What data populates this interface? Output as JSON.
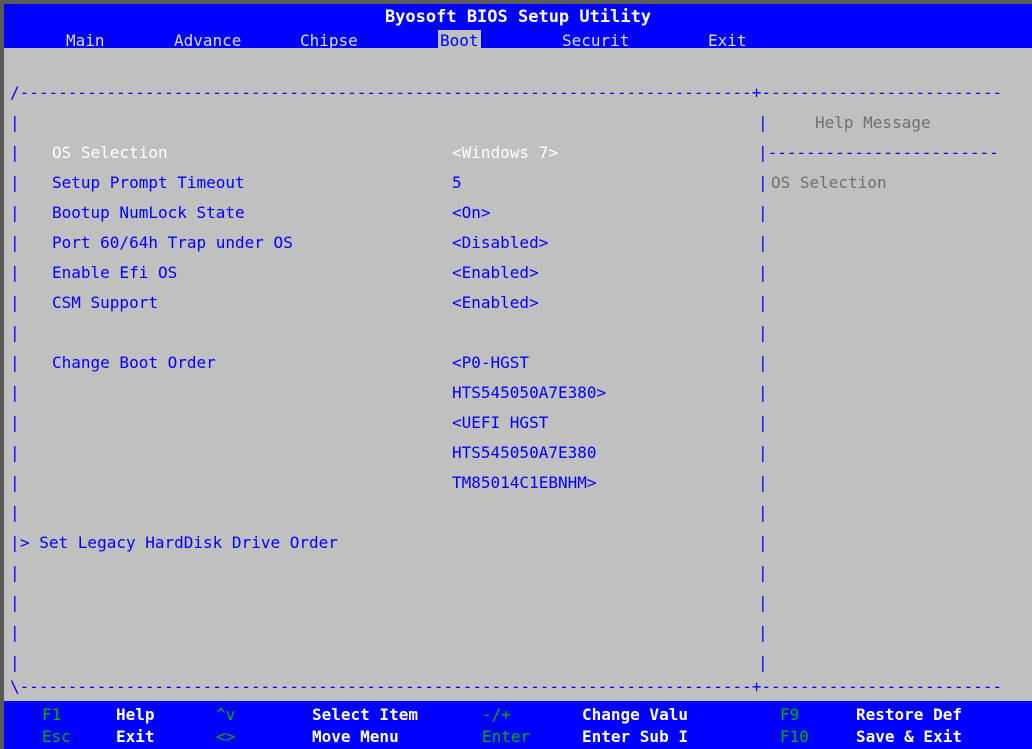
{
  "title": "Byosoft BIOS Setup Utility",
  "tabs": [
    {
      "label": "Main",
      "active": false
    },
    {
      "label": "Advance",
      "active": false
    },
    {
      "label": "Chipse",
      "active": false
    },
    {
      "label": "Boot",
      "active": true
    },
    {
      "label": "Securit",
      "active": false
    },
    {
      "label": "Exit",
      "active": false
    }
  ],
  "frame": {
    "top_border": "/----------------------------------------------------------------------------+-------------------------",
    "bottom_border": "\\----------------------------------------------------------------------------+-------------------------",
    "help_divider": "|------------------------",
    "pipe": "|"
  },
  "settings": [
    {
      "label": "OS Selection",
      "value": "<Windows 7>",
      "highlighted": true
    },
    {
      "label": "Setup Prompt Timeout",
      "value": "5"
    },
    {
      "label": "Bootup NumLock State",
      "value": "<On>"
    },
    {
      "label": "Port 60/64h Trap under OS",
      "value": "<Disabled>"
    },
    {
      "label": "Enable Efi OS",
      "value": "<Enabled>"
    },
    {
      "label": "CSM Support",
      "value": "<Enabled>"
    }
  ],
  "boot_order": {
    "label": "Change Boot Order",
    "values": [
      "<P0-HGST",
      "HTS545050A7E380>",
      "<UEFI HGST",
      "HTS545050A7E380",
      "TM85014C1EBNHM>"
    ]
  },
  "submenu": {
    "label": "> Set Legacy HardDisk Drive Order"
  },
  "help": {
    "header": "Help Message",
    "text": "OS Selection"
  },
  "footer": {
    "row1": [
      {
        "key": "F1",
        "label": "Help"
      },
      {
        "key": "^v",
        "label": "Select Item"
      },
      {
        "key": "-/+",
        "label": "Change Valu"
      },
      {
        "key": "F9",
        "label": "Restore Def"
      }
    ],
    "row2": [
      {
        "key": "Esc",
        "label": "Exit"
      },
      {
        "key": "<>",
        "label": "Move Menu"
      },
      {
        "key": "Enter",
        "label": "Enter Sub I"
      },
      {
        "key": "F10",
        "label": "Save & Exit"
      }
    ]
  },
  "colors": {
    "background": "#c0c0c0",
    "bar": "#0000ff",
    "text": "#0000ff",
    "highlight": "#ffffff",
    "muted": "#6f6f6f",
    "key": "#00b000"
  }
}
